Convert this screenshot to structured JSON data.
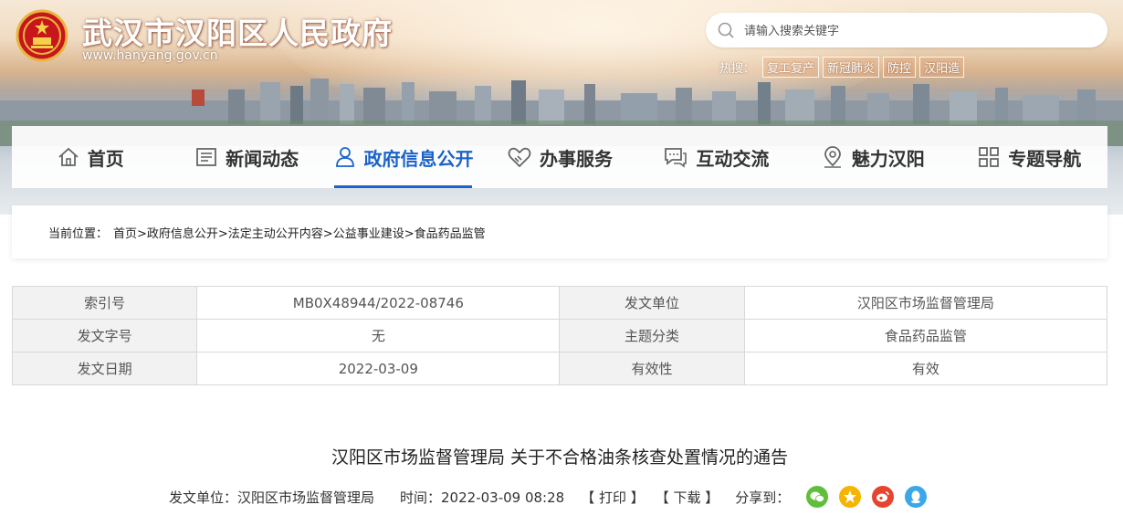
{
  "header": {
    "site_title": "武汉市汉阳区人民政府",
    "site_url": "www.hanyang.gov.cn",
    "search_placeholder": "请输入搜索关键字",
    "hot_label": "热搜：",
    "hot_tags": [
      "复工复产",
      "新冠肺炎",
      "防控",
      "汉阳造"
    ]
  },
  "nav": [
    {
      "label": "首页",
      "icon": "home-icon"
    },
    {
      "label": "新闻动态",
      "icon": "news-icon"
    },
    {
      "label": "政府信息公开",
      "icon": "person-icon",
      "active": true
    },
    {
      "label": "办事服务",
      "icon": "handshake-icon"
    },
    {
      "label": "互动交流",
      "icon": "chat-icon"
    },
    {
      "label": "魅力汉阳",
      "icon": "location-icon"
    },
    {
      "label": "专题导航",
      "icon": "grid-icon"
    }
  ],
  "breadcrumb": {
    "label": "当前位置：",
    "path": "首页>政府信息公开>法定主动公开内容>公益事业建设>食品药品监管"
  },
  "info_table": [
    [
      "索引号",
      "MB0X48944/2022-08746",
      "发文单位",
      "汉阳区市场监督管理局"
    ],
    [
      "发文字号",
      "无",
      "主题分类",
      "食品药品监管"
    ],
    [
      "发文日期",
      "2022-03-09",
      "有效性",
      "有效"
    ]
  ],
  "article": {
    "title": "汉阳区市场监督管理局 关于不合格油条核查处置情况的通告",
    "issuer": "发文单位：汉阳区市场监督管理局",
    "time": "时间：2022-03-09 08:28",
    "print_label": "【 打印 】",
    "download_label": "【 下载 】",
    "share_label": "分享到：",
    "share_icons": [
      "wechat-icon",
      "qzone-icon",
      "weibo-icon",
      "qq-icon"
    ]
  },
  "colors": {
    "accent": "#1b63c9",
    "wechat": "#5fbf3c",
    "qzone": "#f5b400",
    "weibo": "#e6442e",
    "qq": "#3aa7e8"
  }
}
